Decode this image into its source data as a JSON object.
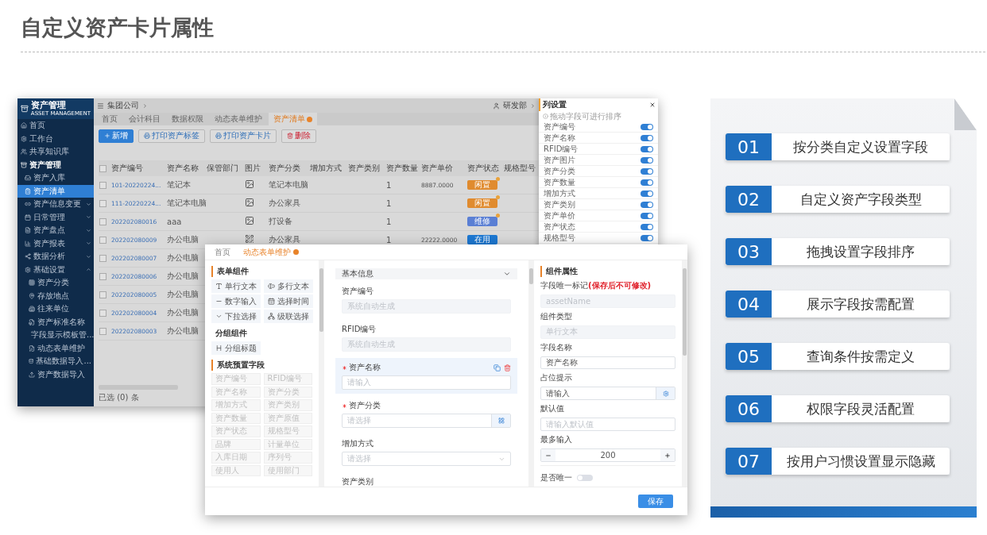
{
  "title": "自定义资产卡片属性",
  "app": {
    "logo": "资产管理",
    "logo_sub": "ASSET MANAGEMENT",
    "sidebar": [
      {
        "label": "首页",
        "selected": false
      },
      {
        "label": "工作台",
        "selected": false
      },
      {
        "label": "共享知识库",
        "selected": false
      },
      {
        "label": "资产管理",
        "selected": false,
        "children": [
          {
            "label": "资产入库",
            "selected": false
          },
          {
            "label": "资产清单",
            "selected": true
          },
          {
            "label": "资产信息变更",
            "selected": false,
            "expanded": false
          },
          {
            "label": "日常管理",
            "selected": false,
            "expanded": false
          },
          {
            "label": "资产盘点",
            "selected": false,
            "expanded": false
          },
          {
            "label": "资产报表",
            "selected": false,
            "expanded": false
          },
          {
            "label": "数据分析",
            "selected": false,
            "expanded": false
          },
          {
            "label": "基础设置",
            "selected": false,
            "expanded": true,
            "children": [
              {
                "label": "资产分类",
                "selected": false
              },
              {
                "label": "存放地点",
                "selected": false
              },
              {
                "label": "往来单位",
                "selected": false
              },
              {
                "label": "资产标准名称",
                "selected": false
              },
              {
                "label": "字段显示模板管...",
                "selected": false
              },
              {
                "label": "动态表单维护",
                "selected": false
              },
              {
                "label": "基础数据导入...",
                "selected": false
              },
              {
                "label": "资产数据导入",
                "selected": false
              }
            ]
          }
        ]
      }
    ],
    "header_checked": false,
    "company": "集团公司",
    "user": "研发部",
    "tabs": [
      {
        "label": "首页",
        "selected": false
      },
      {
        "label": "会计科目",
        "selected": false
      },
      {
        "label": "数据权限",
        "selected": false
      },
      {
        "label": "动态表单维护",
        "selected": false
      },
      {
        "label": "资产清单",
        "selected": true
      }
    ],
    "toolbar": [
      {
        "label": "新增",
        "kind": "primary"
      },
      {
        "label": "打印资产标签",
        "kind": "outline"
      },
      {
        "label": "打印资产卡片",
        "kind": "outline"
      },
      {
        "label": "删除",
        "kind": "danger"
      }
    ],
    "columns": [
      "资产编号",
      "资产名称",
      "保管部门",
      "图片",
      "资产分类",
      "增加方式",
      "资产类别",
      "资产数量",
      "资产单价",
      "资产状态",
      "规格型号"
    ],
    "rows": [
      {
        "checked": false,
        "cells": [
          "101-20220224...",
          "笔记本",
          null,
          {
            "kind": "photo"
          },
          "笔记本电脑",
          null,
          null,
          "1",
          "8887.0000",
          {
            "status": "闲置",
            "color": "#e08b2f",
            "marked": true
          },
          null
        ]
      },
      {
        "checked": false,
        "cells": [
          "111-20220224...",
          "笔记本电脑",
          null,
          {
            "kind": "photo"
          },
          "办公家具",
          null,
          null,
          "1",
          null,
          {
            "status": "闲置",
            "color": "#e08b2f",
            "marked": true
          },
          null
        ]
      },
      {
        "checked": false,
        "cells": [
          "202202080016",
          "aaa",
          null,
          {
            "kind": "photo"
          },
          "打设备",
          null,
          null,
          "1",
          null,
          {
            "status": "维修",
            "color": "#5a7fd4",
            "marked": true
          },
          null
        ]
      },
      {
        "checked": false,
        "cells": [
          "202202080009",
          "办公电脑",
          null,
          {
            "kind": "qrcode"
          },
          "办公家具",
          null,
          null,
          "1",
          "22222.0000",
          {
            "status": "在用",
            "color": "#1d78d2",
            "marked": false
          },
          null
        ]
      },
      {
        "checked": false,
        "cells": [
          "202202080007",
          "办公电脑"
        ]
      },
      {
        "checked": false,
        "cells": [
          "202202080006",
          "办公电脑"
        ]
      },
      {
        "checked": false,
        "cells": [
          "202202080005",
          "办公电脑"
        ]
      },
      {
        "checked": false,
        "cells": [
          "202202080004",
          "办公电脑"
        ]
      },
      {
        "checked": false,
        "cells": [
          "202202080003",
          "办公电脑"
        ]
      }
    ],
    "footer": "已选 (0) 条",
    "column_settings": {
      "title": "列设置",
      "hint": "拖动字段可进行排序",
      "items": [
        {
          "label": "资产编号",
          "on": true
        },
        {
          "label": "资产名称",
          "on": true
        },
        {
          "label": "RFID编号",
          "on": true
        },
        {
          "label": "资产图片",
          "on": true
        },
        {
          "label": "资产分类",
          "on": true
        },
        {
          "label": "资产数量",
          "on": true
        },
        {
          "label": "增加方式",
          "on": true
        },
        {
          "label": "资产类别",
          "on": true
        },
        {
          "label": "资产单价",
          "on": true
        },
        {
          "label": "资产状态",
          "on": true
        },
        {
          "label": "规格型号",
          "on": true
        }
      ]
    }
  },
  "dialog": {
    "tabs": [
      {
        "label": "首页",
        "selected": false
      },
      {
        "label": "动态表单维护",
        "selected": true
      }
    ],
    "components_title": "表单组件",
    "components": [
      "单行文本",
      "多行文本",
      "数字输入",
      "选择时间",
      "下拉选择",
      "级联选择"
    ],
    "group_title": "分组组件",
    "group_items": [
      "分组标题"
    ],
    "preset_title": "系统预置字段",
    "preset_fields": [
      "资产编号",
      "RFID编号",
      "资产名称",
      "资产分类",
      "增加方式",
      "资产类别",
      "资产数量",
      "资产原值",
      "资产状态",
      "规格型号",
      "品牌",
      "计量单位",
      "入库日期",
      "序列号",
      "使用人",
      "使用部门"
    ],
    "section": {
      "title": "基本信息",
      "expanded": true
    },
    "fields": [
      {
        "label": "资产编号",
        "required": false,
        "selected": false,
        "kind": "disabled",
        "placeholder": "系统自动生成"
      },
      {
        "label": "RFID编号",
        "required": false,
        "selected": false,
        "kind": "disabled",
        "placeholder": "系统自动生成"
      },
      {
        "label": "资产名称",
        "required": true,
        "selected": true,
        "kind": "input",
        "placeholder": "请输入"
      },
      {
        "label": "资产分类",
        "required": true,
        "selected": false,
        "kind": "picker",
        "placeholder": "请选择"
      },
      {
        "label": "增加方式",
        "required": false,
        "selected": false,
        "kind": "select",
        "placeholder": "请选择"
      },
      {
        "label": "资产类别",
        "required": false,
        "selected": false,
        "kind": "label"
      }
    ],
    "properties_title": "组件属性",
    "properties": [
      {
        "label": "字段唯一标记",
        "note": "(保存后不可修改)",
        "kind": "disabled",
        "placeholder": "assetName"
      },
      {
        "label": "组件类型",
        "kind": "disabled",
        "placeholder": "单行文本"
      },
      {
        "label": "字段名称",
        "kind": "input",
        "value": "资产名称"
      },
      {
        "label": "占位提示",
        "kind": "button",
        "value": "请输入"
      },
      {
        "label": "默认值",
        "kind": "input",
        "placeholder": "请输入默认值"
      },
      {
        "label": "最多输入",
        "kind": "stepper",
        "value": "200"
      }
    ],
    "unique": {
      "label": "是否唯一",
      "on": false
    },
    "save": "保存"
  },
  "features": [
    {
      "number": "01",
      "label": "按分类自定义设置字段"
    },
    {
      "number": "02",
      "label": "自定义资产字段类型"
    },
    {
      "number": "03",
      "label": "拖拽设置字段排序"
    },
    {
      "number": "04",
      "label": "展示字段按需配置"
    },
    {
      "number": "05",
      "label": "查询条件按需定义"
    },
    {
      "number": "06",
      "label": "权限字段灵活配置"
    },
    {
      "number": "07",
      "label": "按用户习惯设置显示隐藏"
    }
  ]
}
